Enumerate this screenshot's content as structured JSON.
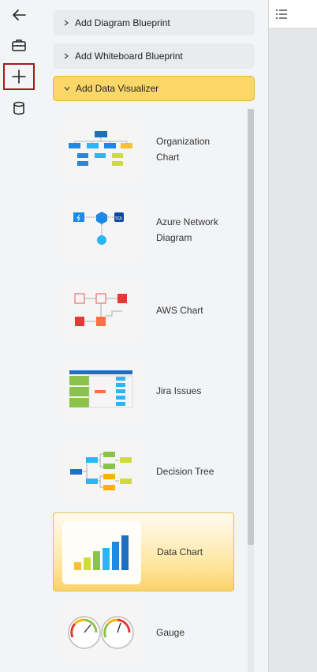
{
  "rail": {
    "items": [
      {
        "icon": "back-arrow-icon"
      },
      {
        "icon": "toolbox-icon"
      },
      {
        "icon": "plus-icon",
        "active": true
      },
      {
        "icon": "database-icon"
      }
    ]
  },
  "panel": {
    "accordions": [
      {
        "label": "Add Diagram Blueprint",
        "expanded": false
      },
      {
        "label": "Add Whiteboard Blueprint",
        "expanded": false
      },
      {
        "label": "Add Data Visualizer",
        "expanded": true
      }
    ],
    "cards": [
      {
        "label": "Organization Chart",
        "selected": false
      },
      {
        "label": "Azure Network Diagram",
        "selected": false
      },
      {
        "label": "AWS Chart",
        "selected": false
      },
      {
        "label": "Jira Issues",
        "selected": false
      },
      {
        "label": "Decision Tree",
        "selected": false
      },
      {
        "label": "Data Chart",
        "selected": true
      },
      {
        "label": "Gauge",
        "selected": false
      }
    ]
  },
  "right_pane": {
    "icon": "list-icon"
  },
  "colors": {
    "accent_yellow": "#fbd76a",
    "active_border": "#a31c1c",
    "panel_bg": "#f3f4f6"
  }
}
